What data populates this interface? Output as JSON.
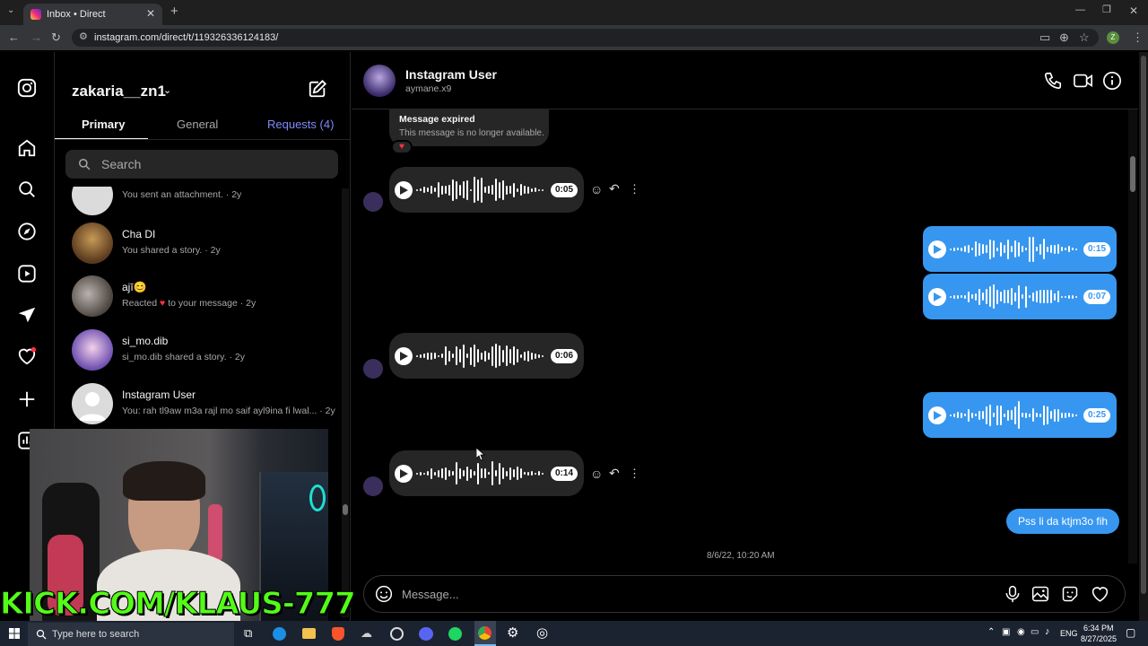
{
  "browser": {
    "tab_title": "Inbox • Direct",
    "url": "instagram.com/direct/t/119326336124183/",
    "profile_initial": "Z"
  },
  "inbox": {
    "username": "zakaria__zn1",
    "tabs": [
      {
        "label": "Primary",
        "active": true
      },
      {
        "label": "General",
        "active": false
      },
      {
        "label": "Requests (4)",
        "active": false
      }
    ],
    "search_placeholder": "Search",
    "threads": [
      {
        "name": "",
        "preview": "You sent an attachment. · 2y",
        "partial": true
      },
      {
        "name": "Cha DI",
        "preview": "You shared a story. · 2y"
      },
      {
        "name": "ajī😊",
        "preview_prefix": "Reacted",
        "preview_suffix": "to your message · 2y",
        "reaction_icon": "heart-icon"
      },
      {
        "name": "si_mo.dib",
        "preview": "si_mo.dib shared a story. · 2y"
      },
      {
        "name": "Instagram User",
        "preview": "You: rah tl9aw m3a rajl mo saif ayl9ina fi lwal... · 2y"
      }
    ]
  },
  "chat": {
    "title": "Instagram User",
    "subtitle": "aymane.x9",
    "expired_title": "Message expired",
    "expired_body": "This message is no longer available.",
    "voice_messages": [
      {
        "direction": "in",
        "duration": "0:05"
      },
      {
        "direction": "out",
        "duration": "0:15"
      },
      {
        "direction": "out",
        "duration": "0:07"
      },
      {
        "direction": "in",
        "duration": "0:06"
      },
      {
        "direction": "out",
        "duration": "0:25"
      },
      {
        "direction": "in",
        "duration": "0:14"
      }
    ],
    "text_message": "Pss li da ktjm3o fih",
    "timestamp": "8/6/22, 10:20 AM",
    "input_placeholder": "Message..."
  },
  "taskbar": {
    "search_placeholder": "Type here to search",
    "language": "ENG",
    "time": "6:34 PM",
    "date": "8/27/2025"
  },
  "overlay": {
    "stream_url": "KICK.COM/KLAUS-777"
  },
  "colors": {
    "accent_blue": "#3797f0",
    "kick_green": "#53fc18",
    "notification_red": "#ff3040"
  }
}
